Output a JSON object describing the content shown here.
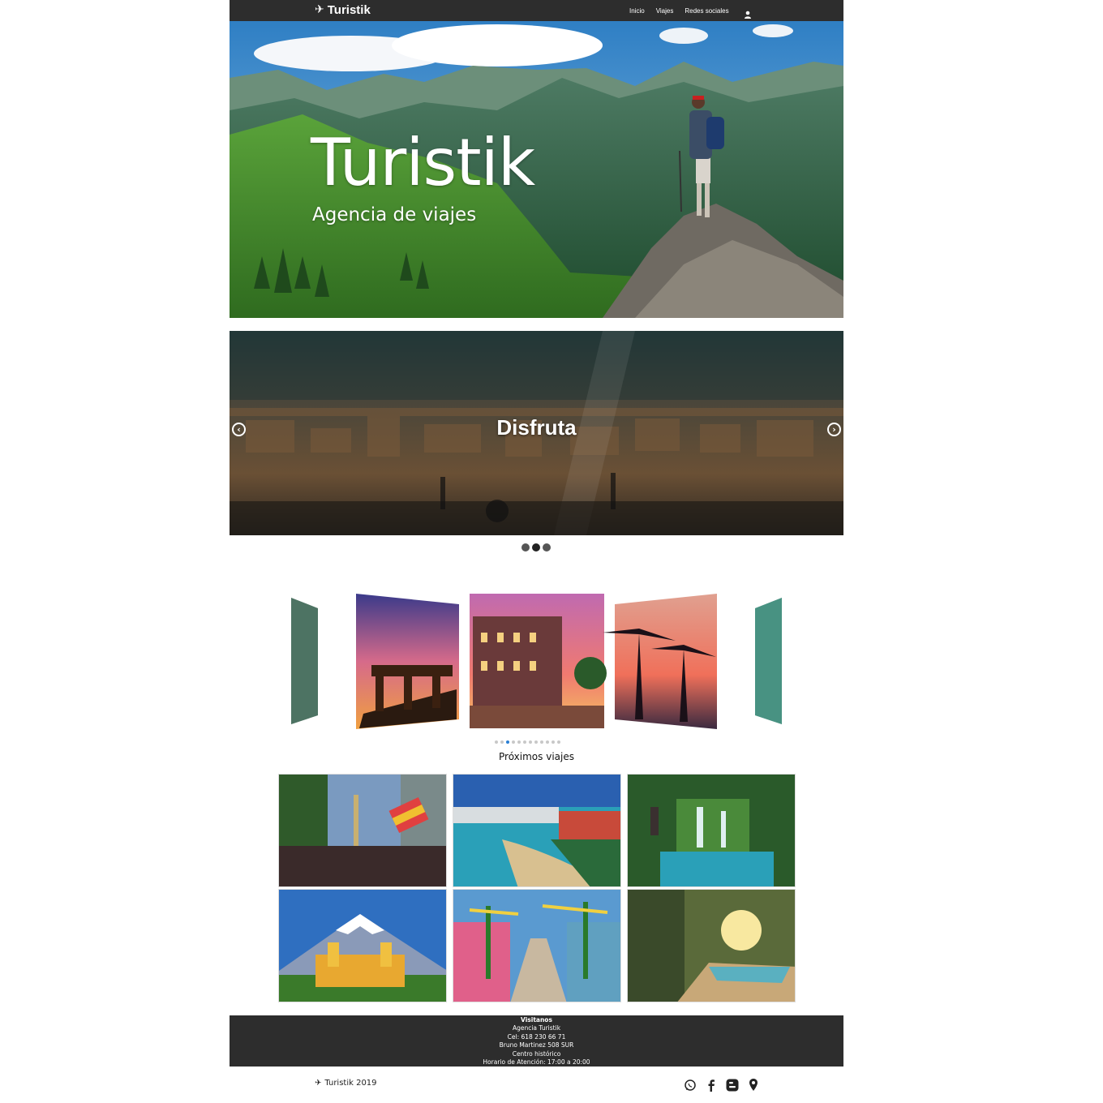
{
  "nav": {
    "brand": "Turistik",
    "links": [
      "Inicio",
      "Viajes",
      "Redes sociales"
    ]
  },
  "hero": {
    "title": "Turistik",
    "subtitle": "Agencia de viajes"
  },
  "slider": {
    "caption": "Disfruta",
    "prev_icon": "chevron-left-icon",
    "next_icon": "chevron-right-icon",
    "dots": 3,
    "active_dot": 1
  },
  "coverflow": {
    "dots": 12,
    "active_dot": 2
  },
  "upcoming": {
    "title": "Próximos viajes"
  },
  "footer": {
    "title": "Visitanos",
    "lines": [
      "Agencia Turistik",
      "Cel: 618 230 66 71",
      "Bruno Martinez 508 SUR",
      "Centro histórico",
      "Horario de Atención: 17:00 a 20:00"
    ]
  },
  "bottom": {
    "copyright": "Turistik 2019",
    "social_icons": [
      "whatsapp-icon",
      "facebook-icon",
      "blogger-icon",
      "location-pin-icon"
    ]
  },
  "colors": {
    "navbar": "#2d2d2d",
    "footer": "#2d2d2d",
    "active_dot": "#2a7fd4"
  }
}
